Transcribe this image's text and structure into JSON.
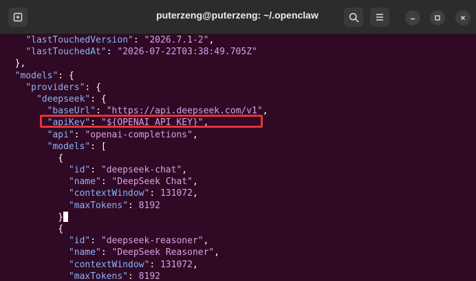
{
  "window": {
    "title": "puterzeng@puterzeng: ~/.openclaw",
    "icons": {
      "new_tab": "new-tab-icon",
      "search": "search-icon",
      "menu": "hamburger-menu-icon",
      "minimize": "minimize-icon",
      "maximize": "maximize-icon",
      "close": "close-icon"
    }
  },
  "colors": {
    "terminal_bg": "#300a24",
    "key": "#8ab4f8",
    "string": "#d9a0e6",
    "highlight": "#e8323c"
  },
  "terminal": {
    "l1": {
      "indent": "    ",
      "key": "\"lastTouchedVersion\"",
      "sep": ": ",
      "val": "\"2026.7.1-2\"",
      "end": ","
    },
    "l2": {
      "indent": "    ",
      "key": "\"lastTouchedAt\"",
      "sep": ": ",
      "val": "\"2026-07-22T03:38:49.705Z\"",
      "end": ""
    },
    "l3": {
      "text": "  },"
    },
    "l4": {
      "indent": "  ",
      "key": "\"models\"",
      "sep": ": ",
      "end": "{"
    },
    "l5": {
      "indent": "    ",
      "key": "\"providers\"",
      "sep": ": ",
      "end": "{"
    },
    "l6": {
      "indent": "      ",
      "key": "\"deepseek\"",
      "sep": ": ",
      "end": "{"
    },
    "l7": {
      "indent": "        ",
      "key": "\"baseUrl\"",
      "sep": ": ",
      "val": "\"https://api.deepseek.com/v1\"",
      "end": ","
    },
    "l8": {
      "indent": "        ",
      "key": "\"apiKey\"",
      "sep": ": ",
      "val": "\"${OPENAI_API_KEY}\"",
      "end": ","
    },
    "l9": {
      "indent": "        ",
      "key": "\"api\"",
      "sep": ": ",
      "val": "\"openai-completions\"",
      "end": ","
    },
    "l10": {
      "indent": "        ",
      "key": "\"models\"",
      "sep": ": ",
      "end": "["
    },
    "l11": {
      "text": "          {"
    },
    "l12": {
      "indent": "            ",
      "key": "\"id\"",
      "sep": ": ",
      "val": "\"deepseek-chat\"",
      "end": ","
    },
    "l13": {
      "indent": "            ",
      "key": "\"name\"",
      "sep": ": ",
      "val": "\"DeepSeek Chat\"",
      "end": ","
    },
    "l14": {
      "indent": "            ",
      "key": "\"contextWindow\"",
      "sep": ": ",
      "val": "131072",
      "end": ","
    },
    "l15": {
      "indent": "            ",
      "key": "\"maxTokens\"",
      "sep": ": ",
      "val": "8192",
      "end": ""
    },
    "l16": {
      "indent": "          ",
      "text": "}"
    },
    "l17": {
      "text": "          {"
    },
    "l18": {
      "indent": "            ",
      "key": "\"id\"",
      "sep": ": ",
      "val": "\"deepseek-reasoner\"",
      "end": ","
    },
    "l19": {
      "indent": "            ",
      "key": "\"name\"",
      "sep": ": ",
      "val": "\"DeepSeek Reasoner\"",
      "end": ","
    },
    "l20": {
      "indent": "            ",
      "key": "\"contextWindow\"",
      "sep": ": ",
      "val": "131072",
      "end": ","
    },
    "l21": {
      "indent": "            ",
      "key": "\"maxTokens\"",
      "sep": ": ",
      "val": "8192",
      "end": ""
    }
  }
}
